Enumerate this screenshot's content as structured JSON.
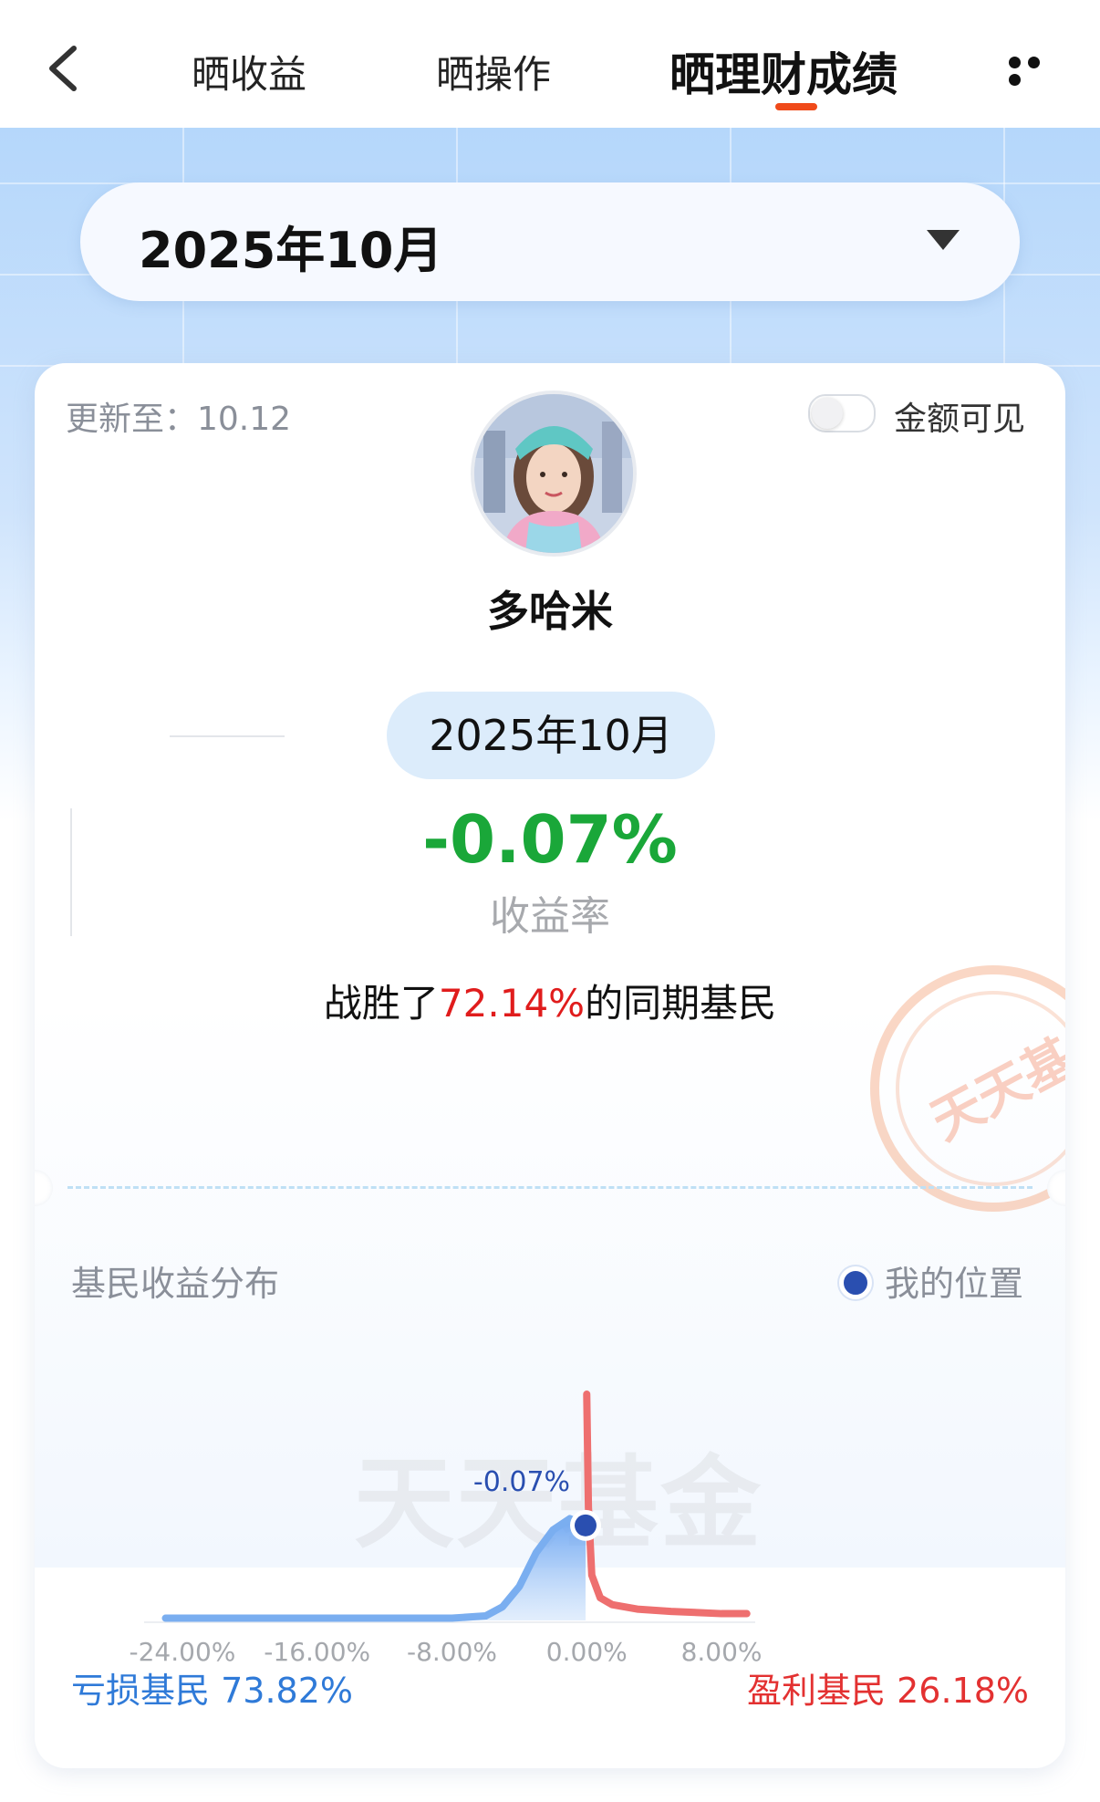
{
  "nav": {
    "tabs": [
      {
        "label": "晒收益"
      },
      {
        "label": "晒操作"
      },
      {
        "label": "晒理财成绩"
      }
    ],
    "active_tab": "晒理财成绩",
    "back_icon": "chevron-left-icon",
    "more_icon": "more-dots-icon"
  },
  "month_selector": {
    "value": "2025年10月",
    "icon": "caret-down-icon"
  },
  "card": {
    "updated": "更新至：10.12",
    "toggle_label": "金额可见",
    "toggle_on": false,
    "nickname": "多哈米",
    "period": "2025年10月",
    "return_value": "-0.07%",
    "return_label": "收益率",
    "beat_prefix": "战胜了",
    "beat_percent": "72.14%",
    "beat_suffix": "的同期基民",
    "stamp_text": "天天基金"
  },
  "distribution": {
    "title": "基民收益分布",
    "legend_label": "我的位置",
    "loss_label": "亏损基民",
    "loss_percent": "73.82%",
    "profit_label": "盈利基民",
    "profit_percent": "26.18%",
    "watermark": "天天基金"
  },
  "colors": {
    "accent": "#f04a1a",
    "loss_blue": "#2f7ad8",
    "profit_red": "#e33131",
    "return_green": "#1aa739",
    "marker": "#2a4fb0"
  },
  "chart_data": {
    "type": "area",
    "title": "基民收益分布",
    "xlabel": "",
    "ylabel": "",
    "x_ticks": [
      "-24.00%",
      "-16.00%",
      "-8.00%",
      "0.00%",
      "8.00%"
    ],
    "xlim": [
      -26,
      10
    ],
    "series": [
      {
        "name": "亏损基民",
        "color": "#7aaef0",
        "x": [
          -25,
          -24,
          -20,
          -16,
          -12,
          -8,
          -6,
          -5,
          -4,
          -3,
          -2,
          -1,
          -0.07
        ],
        "y": [
          0.01,
          0.01,
          0.01,
          0.01,
          0.01,
          0.01,
          0.02,
          0.06,
          0.15,
          0.3,
          0.4,
          0.45,
          0.42
        ]
      },
      {
        "name": "盈利基民",
        "color": "#ee6f6f",
        "x": [
          0.0,
          0.1,
          0.3,
          0.8,
          1.5,
          3,
          5,
          8,
          9.5
        ],
        "y": [
          1.0,
          0.5,
          0.2,
          0.1,
          0.07,
          0.05,
          0.04,
          0.03,
          0.03
        ]
      }
    ],
    "marker": {
      "x": -0.07,
      "label": "-0.07%"
    },
    "grid": false
  }
}
